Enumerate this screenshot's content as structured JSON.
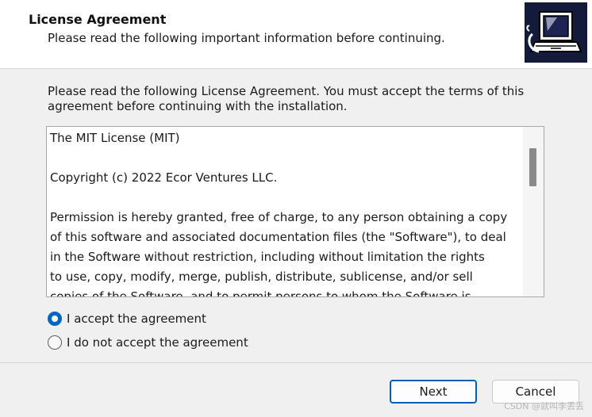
{
  "header": {
    "title": "License Agreement",
    "subtitle": "Please read the following important information before continuing."
  },
  "main": {
    "intro": "Please read the following License Agreement. You must accept the terms of this agreement before continuing with the installation.",
    "license_paragraphs": [
      "The MIT License (MIT)",
      "Copyright (c) 2022 Ecor Ventures LLC.",
      "Permission is hereby granted, free of charge, to any person obtaining a copy\nof this software and associated documentation files (the \"Software\"), to deal\nin the Software without restriction, including without limitation the rights\nto use, copy, modify, merge, publish, distribute, sublicense, and/or sell\ncopies of the Software, and to permit persons to whom the Software is"
    ],
    "options": {
      "accept_label": "I accept the agreement",
      "decline_label": "I do not accept the agreement",
      "selected": "accept"
    }
  },
  "footer": {
    "next_label": "Next",
    "cancel_label": "Cancel"
  },
  "watermark": "CSDN @就叫李丢丢",
  "colors": {
    "accent": "#0067c0",
    "header_bg": "#ffffff",
    "body_bg": "#f0f0f0",
    "wizard_image_bg": "#141a3a"
  },
  "icons": {
    "wizard_image": "computer-installer-icon",
    "radio_selected": "radio-checked-icon",
    "radio_unselected": "radio-unchecked-icon"
  }
}
